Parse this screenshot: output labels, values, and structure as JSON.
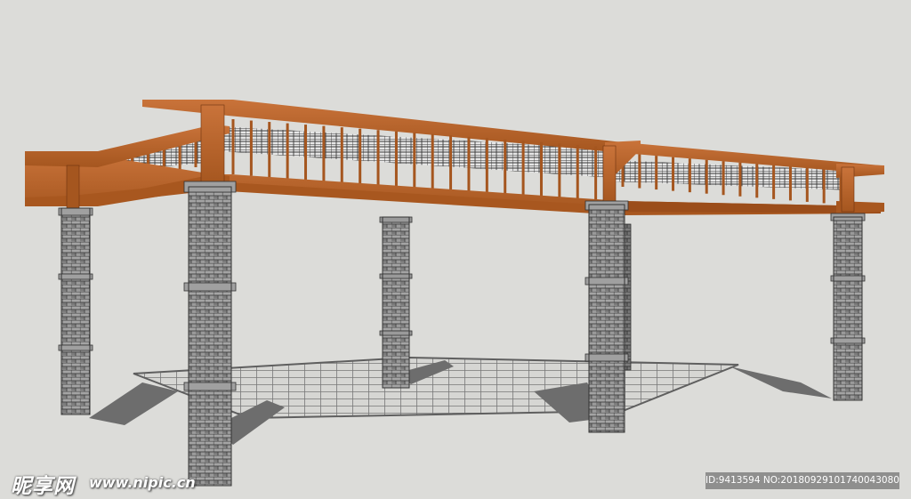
{
  "colors": {
    "background": "#dcdcd9",
    "wood": "#b8642a",
    "wood_dark": "#8a4518",
    "brick": "#8d8d8d",
    "brick_mortar": "#3e3e3e",
    "shadow": "#5a5a5a",
    "lattice": "#3d3d3d"
  },
  "watermark": {
    "logo": "昵享网",
    "url": "www.nipic.cn",
    "id_text": "ID:9413594 NO:20180929101740043080"
  }
}
